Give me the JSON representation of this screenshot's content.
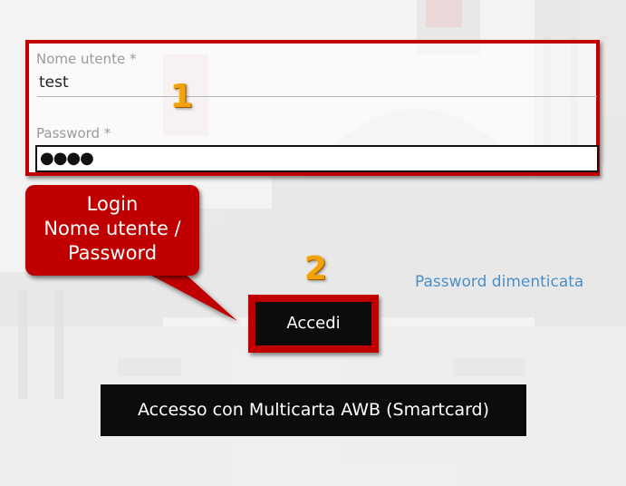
{
  "form": {
    "username_label": "Nome utente *",
    "username_value": "test",
    "password_label": "Password *",
    "password_value": "●●●●"
  },
  "annotations": {
    "step1": "1",
    "step2": "2",
    "callout_line1": "Login",
    "callout_line2": "Nome utente /",
    "callout_line3": "Password"
  },
  "links": {
    "forgot_password": "Password dimenticata"
  },
  "buttons": {
    "login": "Accedi",
    "smartcard": "Accesso con Multicarta AWB (Smartcard)"
  },
  "colors": {
    "highlight": "#c00000",
    "link": "#4a8fc8",
    "button_bg": "#0c0c0c",
    "step_number": "#f2a20c"
  }
}
